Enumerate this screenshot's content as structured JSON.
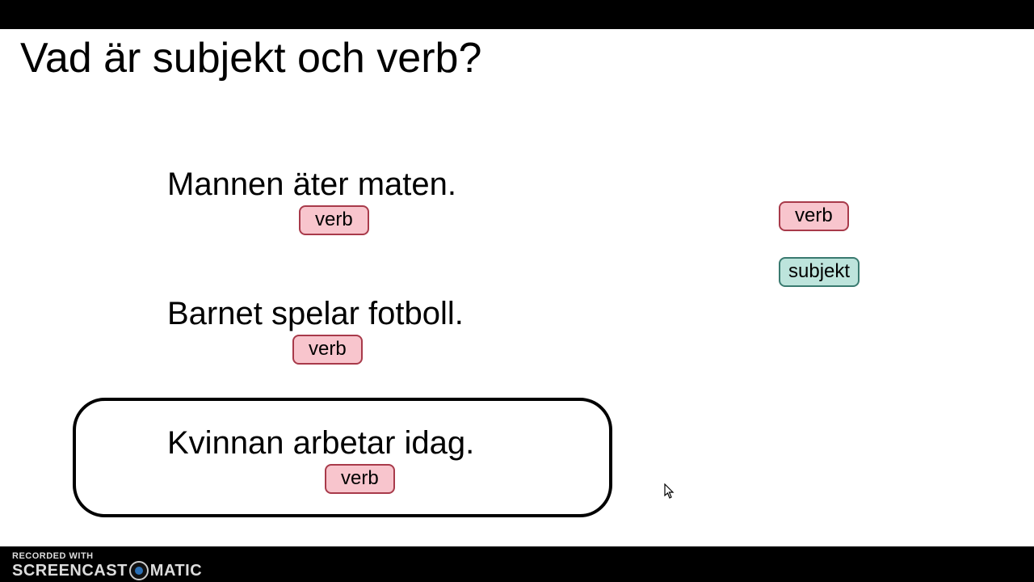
{
  "title": "Vad är subjekt och verb?",
  "sentences": [
    {
      "text": "Mannen äter maten.",
      "tag": "verb"
    },
    {
      "text": "Barnet spelar fotboll.",
      "tag": "verb"
    },
    {
      "text": "Kvinnan arbetar idag.",
      "tag": "verb"
    }
  ],
  "legend": {
    "verb": "verb",
    "subjekt": "subjekt"
  },
  "watermark": {
    "line1": "RECORDED WITH",
    "brand_left": "SCREENCAST",
    "brand_right": "MATIC"
  }
}
